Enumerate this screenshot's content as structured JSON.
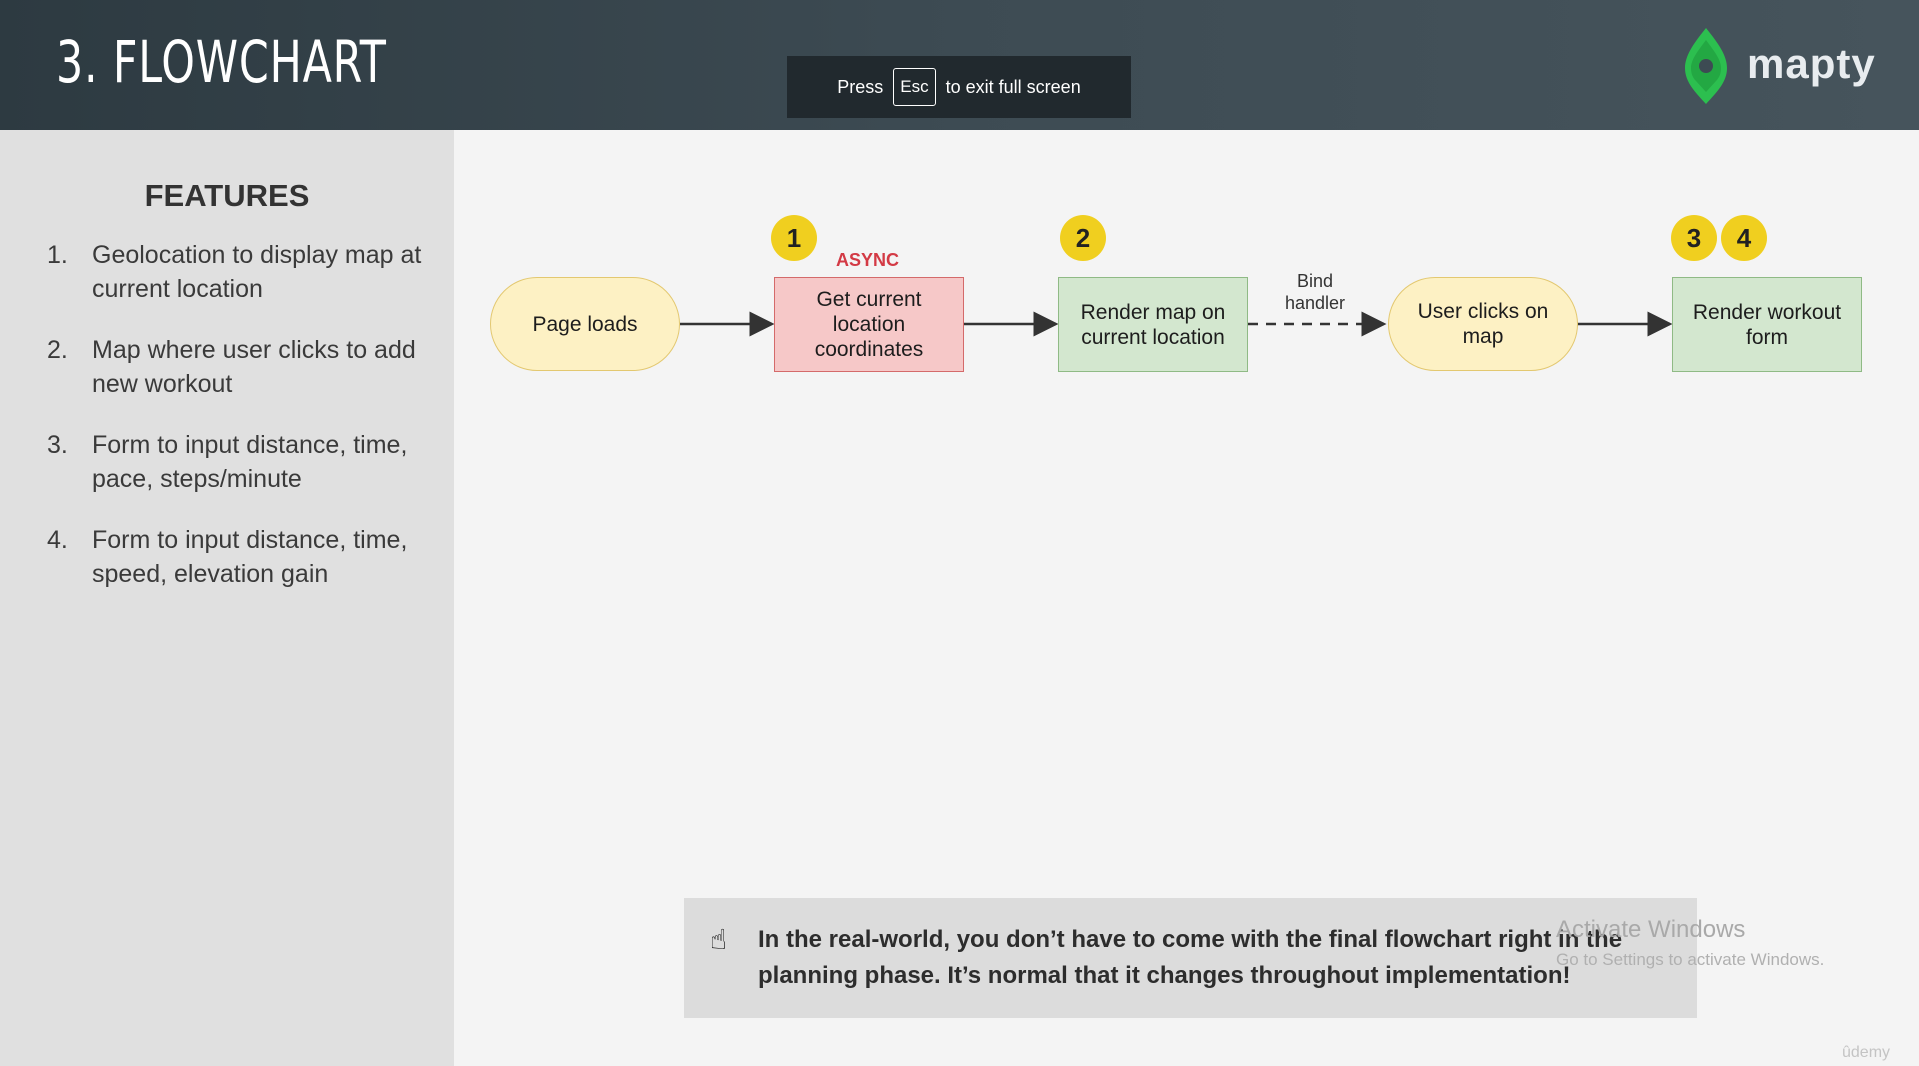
{
  "header": {
    "title": "3. FLOWCHART",
    "esc_prefix": "Press",
    "esc_key": "Esc",
    "esc_suffix": "to exit full screen",
    "logo_text": "mapty"
  },
  "sidebar": {
    "heading": "FEATURES",
    "features": [
      {
        "num": "1.",
        "text": "Geolocation to display map at current location"
      },
      {
        "num": "2.",
        "text": "Map where user clicks to add new workout"
      },
      {
        "num": "3.",
        "text": "Form to input distance, time, pace, steps/minute"
      },
      {
        "num": "4.",
        "text": "Form to input distance, time, speed, elevation gain"
      }
    ]
  },
  "flowchart": {
    "nodes": {
      "page_loads": "Page loads",
      "get_location": "Get current location coordinates",
      "render_map": "Render map on current location",
      "user_clicks": "User clicks on map",
      "render_form": "Render workout form"
    },
    "badges": [
      "1",
      "2",
      "3",
      "4"
    ],
    "async_label": "ASYNC",
    "edge_label_line1": "Bind",
    "edge_label_line2": "handler"
  },
  "note": {
    "icon": "pointing-up-hand-icon",
    "text": "In the real-world, you don’t have to come with the final flowchart right in the planning phase. It’s normal that it changes throughout implementation!"
  },
  "overlay": {
    "watermark_title": "Activate Windows",
    "watermark_sub": "Go to Settings to activate Windows.",
    "udemy": "ûdemy"
  },
  "colors": {
    "header_bg": "#3a474e",
    "badge": "#f0cf1f",
    "async": "#d33a45",
    "oval_fill": "#fdf1c4",
    "red_fill": "#f6c8c8",
    "green_fill": "#d3e7cf",
    "logo_green": "#2cbf4f"
  }
}
